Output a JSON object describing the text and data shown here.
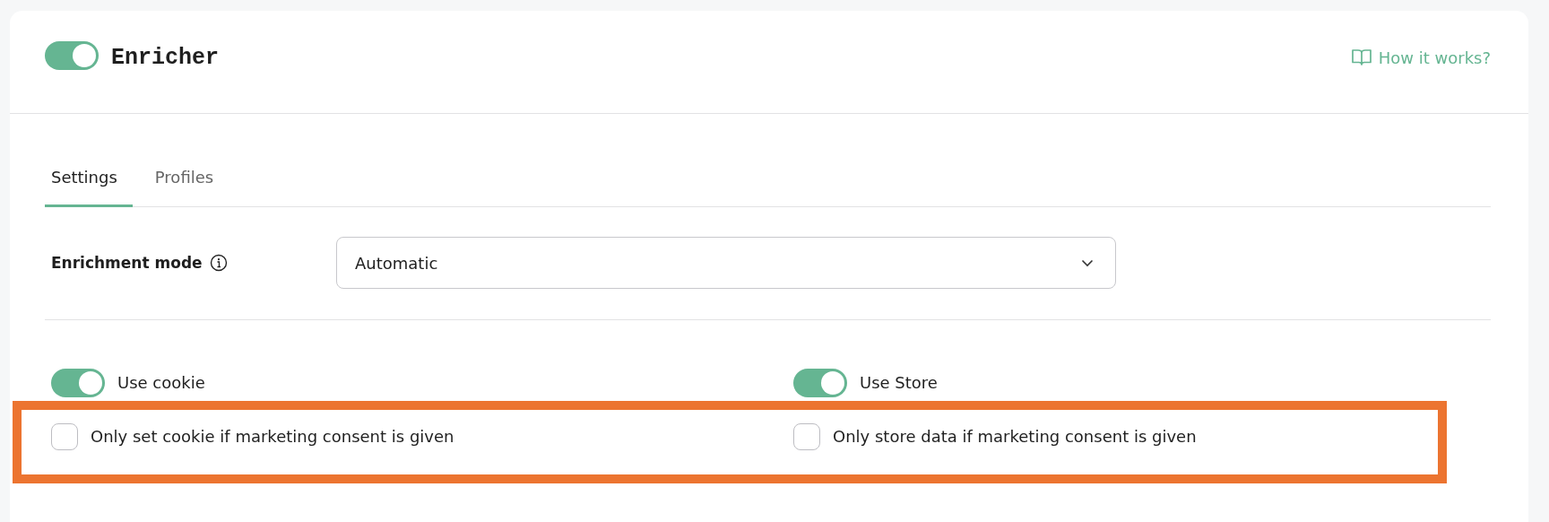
{
  "header": {
    "enabled": true,
    "title": "Enricher",
    "help_link": "How it works?"
  },
  "tabs": [
    {
      "label": "Settings",
      "selected": true
    },
    {
      "label": "Profiles",
      "selected": false
    }
  ],
  "enrichment_mode": {
    "label": "Enrichment mode",
    "value": "Automatic"
  },
  "toggles": [
    {
      "label": "Use cookie",
      "on": true
    },
    {
      "label": "Use Store",
      "on": true
    }
  ],
  "checkboxes": [
    {
      "label": "Only set cookie if marketing consent is given",
      "checked": false
    },
    {
      "label": "Only store data if marketing consent is given",
      "checked": false
    }
  ],
  "highlight": {
    "shown": true
  }
}
